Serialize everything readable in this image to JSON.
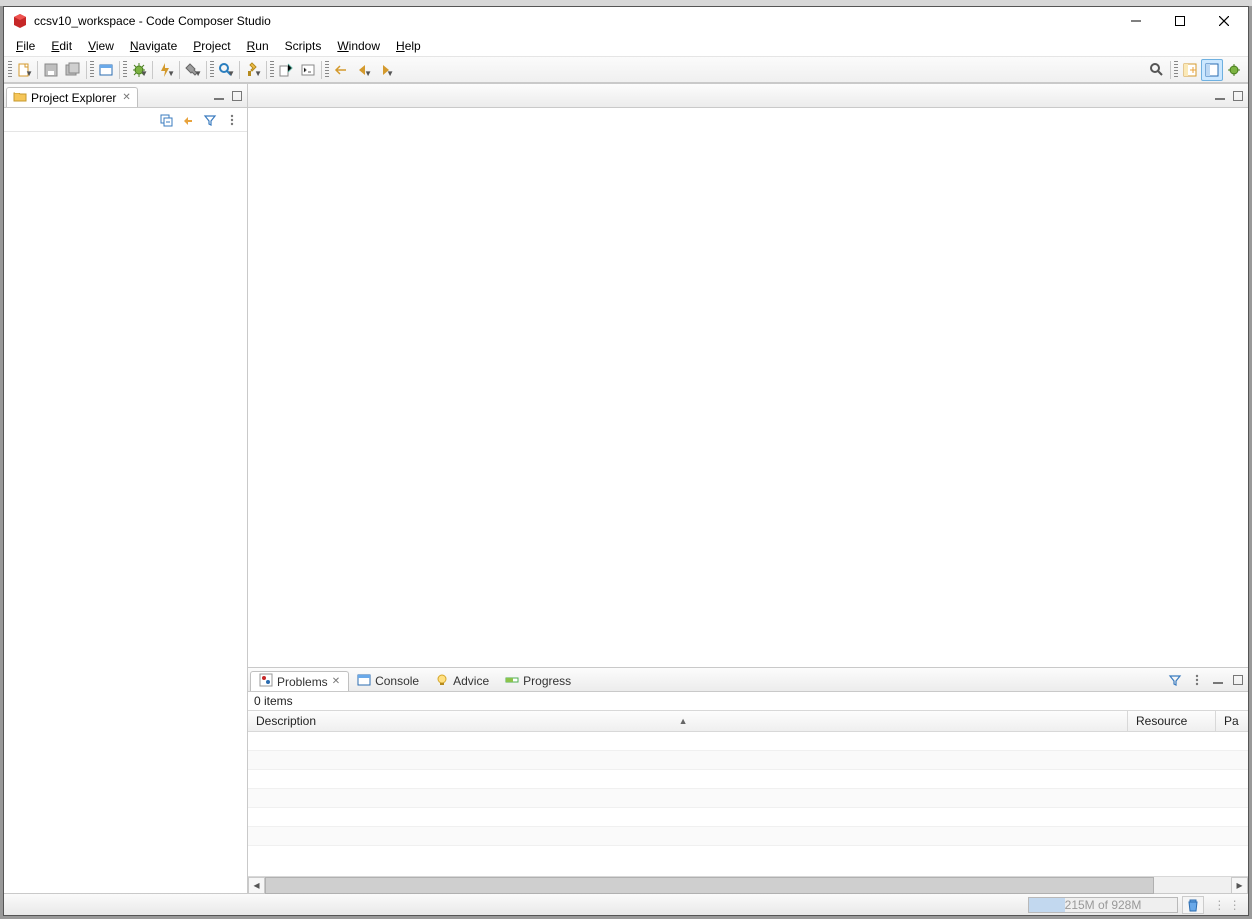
{
  "window": {
    "title": "ccsv10_workspace - Code Composer Studio"
  },
  "menubar": {
    "file": "File",
    "edit": "Edit",
    "view": "View",
    "navigate": "Navigate",
    "project": "Project",
    "run": "Run",
    "scripts": "Scripts",
    "window": "Window",
    "help": "Help"
  },
  "project_explorer": {
    "title": "Project Explorer"
  },
  "bottom_tabs": {
    "problems": "Problems",
    "console": "Console",
    "advice": "Advice",
    "progress": "Progress"
  },
  "problems": {
    "items_count": "0 items",
    "columns": {
      "description": "Description",
      "resource": "Resource",
      "path": "Pa"
    }
  },
  "status": {
    "heap": "215M of 928M"
  }
}
